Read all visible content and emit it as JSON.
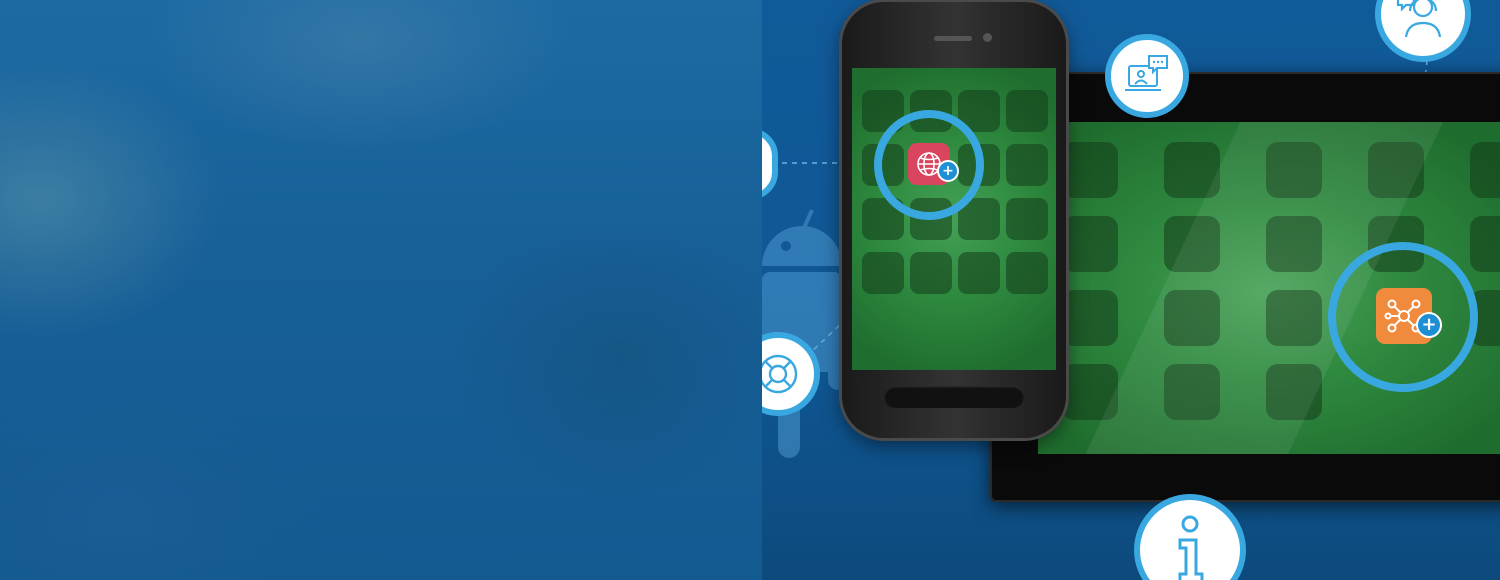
{
  "scene": {
    "accent_color": "#3aa8e0",
    "screen_green": "#2f8a40",
    "phone_app_icon": "globe-icon",
    "tablet_app_icon": "network-nodes-icon",
    "phone_app_color": "#d9455f",
    "tablet_app_color": "#f08a3c",
    "badges": [
      "support-agent-icon",
      "video-chat-icon",
      "lifebuoy-icon",
      "info-icon"
    ],
    "background_icon": "android-icon"
  }
}
